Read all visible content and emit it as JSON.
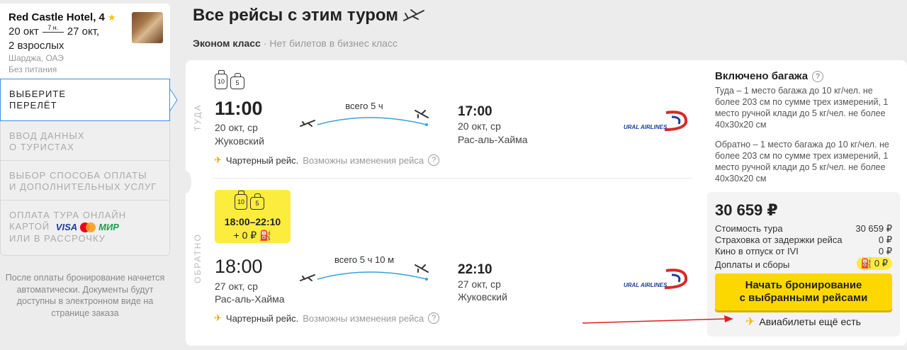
{
  "hotel": {
    "name": "Red Castle Hotel, 4",
    "date_from": "20 окт",
    "nights": "7 н.",
    "date_to": "27 окт,",
    "guests": "2 взрослых",
    "location": "Шарджа, ОАЭ",
    "meal": "Без питания"
  },
  "steps": [
    {
      "label": "Выберите перелёт",
      "line1": "ВЫБЕРИТЕ",
      "line2": "ПЕРЕЛЁТ"
    },
    {
      "line1": "ВВОД ДАННЫХ",
      "line2": "О ТУРИСТАХ"
    },
    {
      "line1": "ВЫБОР СПОСОБА ОПЛАТЫ",
      "line2": "И ДОПОЛНИТЕЛЬНЫХ УСЛУГ"
    },
    {
      "line1": "ОПЛАТА ТУРА ОНЛАЙН",
      "line2": "КАРТОЙ",
      "line3": "ИЛИ В РАССРОЧКУ",
      "visa": "VISA",
      "mir": "МИР"
    }
  ],
  "sidebar_note": "После оплаты бронирование начнется автоматически. Документы будут доступны в электронном виде на странице заказа",
  "page": {
    "title": "Все рейсы с этим туром",
    "class_label": "Эконом класс",
    "class_note": " · Нет билетов в бизнес класс"
  },
  "outbound": {
    "direction": "ТУДА",
    "bag_checked": "10",
    "bag_hand": "5",
    "dep_time": "11:00",
    "dep_date": "20 окт, ср",
    "dep_city": "Жуковский",
    "duration": "всего 5 ч",
    "arr_time": "17:00",
    "arr_date": "20 окт, ср",
    "arr_city": "Рас-аль-Хайма",
    "charter": "Чартерный рейс.",
    "charter_note": "Возможны изменения рейса",
    "airline": "URAL AIRLINES"
  },
  "inbound": {
    "direction": "ОБРАТНО",
    "bag_checked": "10",
    "bag_hand": "5",
    "option_times": "18:00–22:10",
    "option_extra": "+ 0 ₽",
    "dep_time": "18:00",
    "dep_date": "27 окт, ср",
    "dep_city": "Рас-аль-Хайма",
    "duration": "всего 5 ч 10 м",
    "arr_time": "22:10",
    "arr_date": "27 окт, ср",
    "arr_city": "Жуковский",
    "charter": "Чартерный рейс.",
    "charter_note": "Возможны изменения рейса",
    "airline": "URAL AIRLINES"
  },
  "baggage": {
    "title": "Включено багажа",
    "outbound": "Туда – 1 место багажа до 10 кг/чел. не более 203 см по сумме трех измерений, 1 место ручной клади до 5 кг/чел. не более 40x30x20 см",
    "inbound": "Обратно – 1 место багажа до 10 кг/чел. не более 203 см по сумме трех измерений, 1 место ручной клади до 5 кг/чел. не более 40x30x20 см"
  },
  "price": {
    "total": "30 659 ₽",
    "rows": [
      {
        "label": "Стоимость тура",
        "value": "30 659 ₽"
      },
      {
        "label": "Страховка от задержки рейса",
        "value": "0 ₽"
      },
      {
        "label": "Кино в отпуск от IVI",
        "value": "0 ₽"
      },
      {
        "label": "Доплаты и сборы",
        "value": "0 ₽"
      }
    ],
    "book_line1": "Начать бронирование",
    "book_line2": "с выбранными рейсами",
    "more_tickets": "Авиабилеты ещё есть"
  },
  "colors": {
    "accent_yellow": "#fcd800",
    "active_border": "#3a8fe0",
    "route_curve": "#3aa0d8",
    "arrow_red": "#e02020"
  }
}
